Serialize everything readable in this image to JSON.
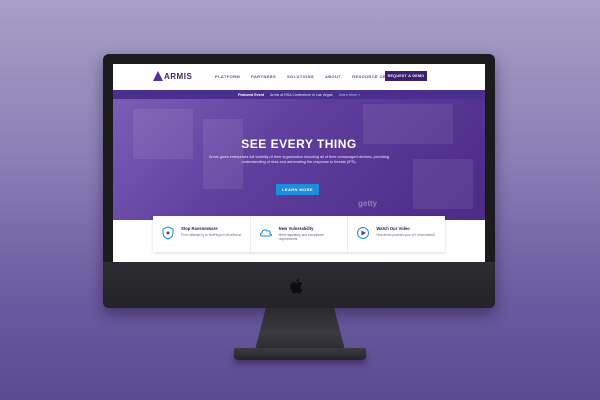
{
  "site": {
    "logo_text": "ARMIS",
    "nav": [
      "PLATFORM",
      "PARTNERS",
      "SOLUTIONS",
      "ABOUT",
      "RESOURCE CENTER"
    ],
    "cta_label": "REQUEST A DEMO"
  },
  "featured": {
    "label": "Featured Event",
    "text": "Armis at RSA Conference in Las Vegas",
    "link": "Learn More »"
  },
  "hero": {
    "title": "SEE EVERY THING",
    "text": "Armis gives enterprises full visibility of their organization including all of their unmanaged devices, providing understanding of risks and automating the response to threats (IPS).",
    "button_label": "LEARN MORE",
    "watermark": "getty"
  },
  "cards": [
    {
      "title": "Stop Ransomware",
      "desc": "From WannaCry to NotPetya to BlueBorne",
      "icon": "shield-icon"
    },
    {
      "title": "New Vulnerability",
      "desc": "Meet regulatory and compliance requirements",
      "icon": "cloud-icon"
    },
    {
      "title": "Watch Our Video",
      "desc": "How Armis protects your IoT environment",
      "icon": "play-icon"
    }
  ],
  "colors": {
    "brand_purple": "#3d1f6e",
    "hero_purple": "#5e3d9c",
    "accent_blue": "#1b8ee0"
  }
}
